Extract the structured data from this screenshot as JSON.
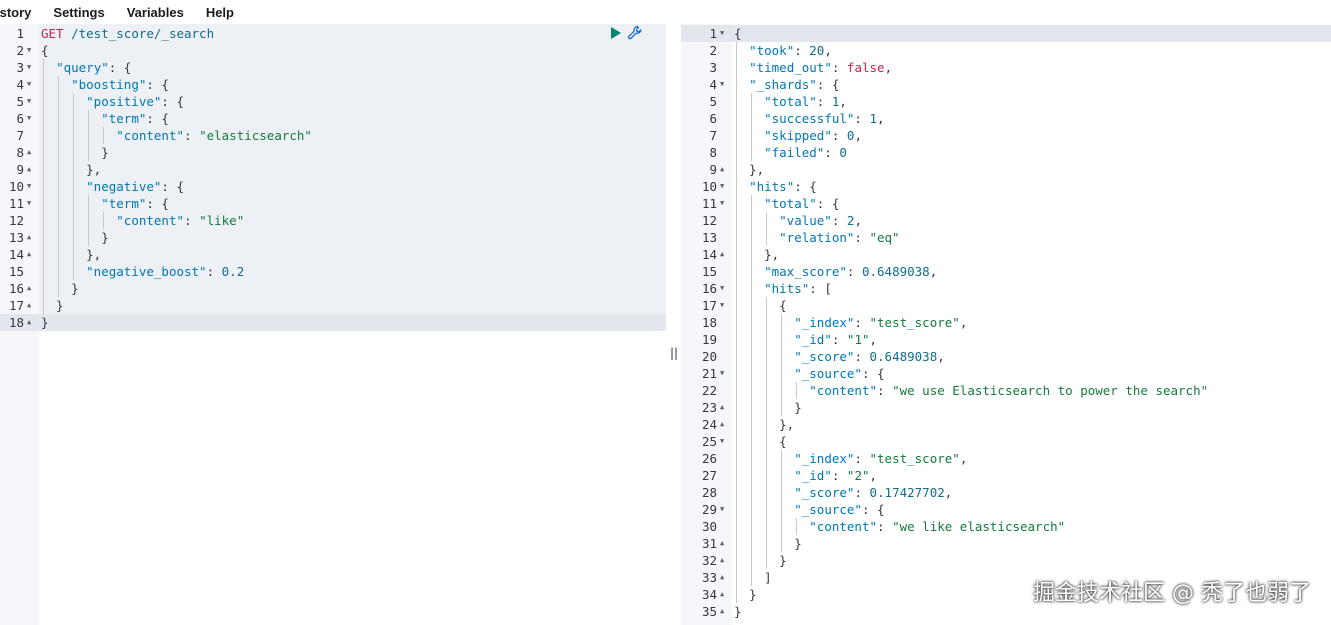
{
  "menu": {
    "items": [
      "istory",
      "Settings",
      "Variables",
      "Help"
    ]
  },
  "request": {
    "lines": [
      {
        "n": "1",
        "fold": "",
        "tokens": [
          [
            "m",
            "GET"
          ],
          [
            "p",
            " "
          ],
          [
            "u",
            "/test_score/_search"
          ]
        ]
      },
      {
        "n": "2",
        "fold": "▼",
        "tokens": [
          [
            "p",
            "{"
          ]
        ]
      },
      {
        "n": "3",
        "fold": "▼",
        "tokens": [
          [
            "p",
            "  "
          ],
          [
            "k",
            "\"query\""
          ],
          [
            "p",
            ": {"
          ]
        ]
      },
      {
        "n": "4",
        "fold": "▼",
        "tokens": [
          [
            "p",
            "    "
          ],
          [
            "k",
            "\"boosting\""
          ],
          [
            "p",
            ": {"
          ]
        ]
      },
      {
        "n": "5",
        "fold": "▼",
        "tokens": [
          [
            "p",
            "      "
          ],
          [
            "k",
            "\"positive\""
          ],
          [
            "p",
            ": {"
          ]
        ]
      },
      {
        "n": "6",
        "fold": "▼",
        "tokens": [
          [
            "p",
            "        "
          ],
          [
            "k",
            "\"term\""
          ],
          [
            "p",
            ": {"
          ]
        ]
      },
      {
        "n": "7",
        "fold": "",
        "tokens": [
          [
            "p",
            "          "
          ],
          [
            "k",
            "\"content\""
          ],
          [
            "p",
            ": "
          ],
          [
            "s",
            "\"elasticsearch\""
          ]
        ]
      },
      {
        "n": "8",
        "fold": "▲",
        "tokens": [
          [
            "p",
            "        }"
          ]
        ]
      },
      {
        "n": "9",
        "fold": "▲",
        "tokens": [
          [
            "p",
            "      },"
          ]
        ]
      },
      {
        "n": "10",
        "fold": "▼",
        "tokens": [
          [
            "p",
            "      "
          ],
          [
            "k",
            "\"negative\""
          ],
          [
            "p",
            ": {"
          ]
        ]
      },
      {
        "n": "11",
        "fold": "▼",
        "tokens": [
          [
            "p",
            "        "
          ],
          [
            "k",
            "\"term\""
          ],
          [
            "p",
            ": {"
          ]
        ]
      },
      {
        "n": "12",
        "fold": "",
        "tokens": [
          [
            "p",
            "          "
          ],
          [
            "k",
            "\"content\""
          ],
          [
            "p",
            ": "
          ],
          [
            "s",
            "\"like\""
          ]
        ]
      },
      {
        "n": "13",
        "fold": "▲",
        "tokens": [
          [
            "p",
            "        }"
          ]
        ]
      },
      {
        "n": "14",
        "fold": "▲",
        "tokens": [
          [
            "p",
            "      },"
          ]
        ]
      },
      {
        "n": "15",
        "fold": "",
        "tokens": [
          [
            "p",
            "      "
          ],
          [
            "k",
            "\"negative_boost\""
          ],
          [
            "p",
            ": "
          ],
          [
            "n",
            "0.2"
          ]
        ]
      },
      {
        "n": "16",
        "fold": "▲",
        "tokens": [
          [
            "p",
            "    }"
          ]
        ]
      },
      {
        "n": "17",
        "fold": "▲",
        "tokens": [
          [
            "p",
            "  }"
          ]
        ]
      },
      {
        "n": "18",
        "fold": "▲",
        "tokens": [
          [
            "p",
            "}"
          ]
        ]
      }
    ]
  },
  "response": {
    "lines": [
      {
        "n": "1",
        "fold": "▼",
        "tokens": [
          [
            "p",
            "{"
          ]
        ]
      },
      {
        "n": "2",
        "fold": "",
        "tokens": [
          [
            "p",
            "  "
          ],
          [
            "k",
            "\"took\""
          ],
          [
            "p",
            ": "
          ],
          [
            "n",
            "20"
          ],
          [
            "p",
            ","
          ]
        ]
      },
      {
        "n": "3",
        "fold": "",
        "tokens": [
          [
            "p",
            "  "
          ],
          [
            "k",
            "\"timed_out\""
          ],
          [
            "p",
            ": "
          ],
          [
            "b",
            "false"
          ],
          [
            "p",
            ","
          ]
        ]
      },
      {
        "n": "4",
        "fold": "▼",
        "tokens": [
          [
            "p",
            "  "
          ],
          [
            "k",
            "\"_shards\""
          ],
          [
            "p",
            ": {"
          ]
        ]
      },
      {
        "n": "5",
        "fold": "",
        "tokens": [
          [
            "p",
            "    "
          ],
          [
            "k",
            "\"total\""
          ],
          [
            "p",
            ": "
          ],
          [
            "n",
            "1"
          ],
          [
            "p",
            ","
          ]
        ]
      },
      {
        "n": "6",
        "fold": "",
        "tokens": [
          [
            "p",
            "    "
          ],
          [
            "k",
            "\"successful\""
          ],
          [
            "p",
            ": "
          ],
          [
            "n",
            "1"
          ],
          [
            "p",
            ","
          ]
        ]
      },
      {
        "n": "7",
        "fold": "",
        "tokens": [
          [
            "p",
            "    "
          ],
          [
            "k",
            "\"skipped\""
          ],
          [
            "p",
            ": "
          ],
          [
            "n",
            "0"
          ],
          [
            "p",
            ","
          ]
        ]
      },
      {
        "n": "8",
        "fold": "",
        "tokens": [
          [
            "p",
            "    "
          ],
          [
            "k",
            "\"failed\""
          ],
          [
            "p",
            ": "
          ],
          [
            "n",
            "0"
          ]
        ]
      },
      {
        "n": "9",
        "fold": "▲",
        "tokens": [
          [
            "p",
            "  },"
          ]
        ]
      },
      {
        "n": "10",
        "fold": "▼",
        "tokens": [
          [
            "p",
            "  "
          ],
          [
            "k",
            "\"hits\""
          ],
          [
            "p",
            ": {"
          ]
        ]
      },
      {
        "n": "11",
        "fold": "▼",
        "tokens": [
          [
            "p",
            "    "
          ],
          [
            "k",
            "\"total\""
          ],
          [
            "p",
            ": {"
          ]
        ]
      },
      {
        "n": "12",
        "fold": "",
        "tokens": [
          [
            "p",
            "      "
          ],
          [
            "k",
            "\"value\""
          ],
          [
            "p",
            ": "
          ],
          [
            "n",
            "2"
          ],
          [
            "p",
            ","
          ]
        ]
      },
      {
        "n": "13",
        "fold": "",
        "tokens": [
          [
            "p",
            "      "
          ],
          [
            "k",
            "\"relation\""
          ],
          [
            "p",
            ": "
          ],
          [
            "s",
            "\"eq\""
          ]
        ]
      },
      {
        "n": "14",
        "fold": "▲",
        "tokens": [
          [
            "p",
            "    },"
          ]
        ]
      },
      {
        "n": "15",
        "fold": "",
        "tokens": [
          [
            "p",
            "    "
          ],
          [
            "k",
            "\"max_score\""
          ],
          [
            "p",
            ": "
          ],
          [
            "n",
            "0.6489038"
          ],
          [
            "p",
            ","
          ]
        ]
      },
      {
        "n": "16",
        "fold": "▼",
        "tokens": [
          [
            "p",
            "    "
          ],
          [
            "k",
            "\"hits\""
          ],
          [
            "p",
            ": ["
          ]
        ]
      },
      {
        "n": "17",
        "fold": "▼",
        "tokens": [
          [
            "p",
            "      {"
          ]
        ]
      },
      {
        "n": "18",
        "fold": "",
        "tokens": [
          [
            "p",
            "        "
          ],
          [
            "k",
            "\"_index\""
          ],
          [
            "p",
            ": "
          ],
          [
            "s",
            "\"test_score\""
          ],
          [
            "p",
            ","
          ]
        ]
      },
      {
        "n": "19",
        "fold": "",
        "tokens": [
          [
            "p",
            "        "
          ],
          [
            "k",
            "\"_id\""
          ],
          [
            "p",
            ": "
          ],
          [
            "s",
            "\"1\""
          ],
          [
            "p",
            ","
          ]
        ]
      },
      {
        "n": "20",
        "fold": "",
        "tokens": [
          [
            "p",
            "        "
          ],
          [
            "k",
            "\"_score\""
          ],
          [
            "p",
            ": "
          ],
          [
            "n",
            "0.6489038"
          ],
          [
            "p",
            ","
          ]
        ]
      },
      {
        "n": "21",
        "fold": "▼",
        "tokens": [
          [
            "p",
            "        "
          ],
          [
            "k",
            "\"_source\""
          ],
          [
            "p",
            ": {"
          ]
        ]
      },
      {
        "n": "22",
        "fold": "",
        "tokens": [
          [
            "p",
            "          "
          ],
          [
            "k",
            "\"content\""
          ],
          [
            "p",
            ": "
          ],
          [
            "s",
            "\"we use Elasticsearch to power the search\""
          ]
        ]
      },
      {
        "n": "23",
        "fold": "▲",
        "tokens": [
          [
            "p",
            "        }"
          ]
        ]
      },
      {
        "n": "24",
        "fold": "▲",
        "tokens": [
          [
            "p",
            "      },"
          ]
        ]
      },
      {
        "n": "25",
        "fold": "▼",
        "tokens": [
          [
            "p",
            "      {"
          ]
        ]
      },
      {
        "n": "26",
        "fold": "",
        "tokens": [
          [
            "p",
            "        "
          ],
          [
            "k",
            "\"_index\""
          ],
          [
            "p",
            ": "
          ],
          [
            "s",
            "\"test_score\""
          ],
          [
            "p",
            ","
          ]
        ]
      },
      {
        "n": "27",
        "fold": "",
        "tokens": [
          [
            "p",
            "        "
          ],
          [
            "k",
            "\"_id\""
          ],
          [
            "p",
            ": "
          ],
          [
            "s",
            "\"2\""
          ],
          [
            "p",
            ","
          ]
        ]
      },
      {
        "n": "28",
        "fold": "",
        "tokens": [
          [
            "p",
            "        "
          ],
          [
            "k",
            "\"_score\""
          ],
          [
            "p",
            ": "
          ],
          [
            "n",
            "0.17427702"
          ],
          [
            "p",
            ","
          ]
        ]
      },
      {
        "n": "29",
        "fold": "▼",
        "tokens": [
          [
            "p",
            "        "
          ],
          [
            "k",
            "\"_source\""
          ],
          [
            "p",
            ": {"
          ]
        ]
      },
      {
        "n": "30",
        "fold": "",
        "tokens": [
          [
            "p",
            "          "
          ],
          [
            "k",
            "\"content\""
          ],
          [
            "p",
            ": "
          ],
          [
            "s",
            "\"we like elasticsearch\""
          ]
        ]
      },
      {
        "n": "31",
        "fold": "▲",
        "tokens": [
          [
            "p",
            "        }"
          ]
        ]
      },
      {
        "n": "32",
        "fold": "▲",
        "tokens": [
          [
            "p",
            "      }"
          ]
        ]
      },
      {
        "n": "33",
        "fold": "▲",
        "tokens": [
          [
            "p",
            "    ]"
          ]
        ]
      },
      {
        "n": "34",
        "fold": "▲",
        "tokens": [
          [
            "p",
            "  }"
          ]
        ]
      },
      {
        "n": "35",
        "fold": "▲",
        "tokens": [
          [
            "p",
            "}"
          ]
        ]
      }
    ]
  },
  "icons": {
    "run": "play-icon",
    "settings": "wrench-icon"
  },
  "splitter_glyph": "||",
  "watermark": "掘金技术社区 @ 秃了也弱了",
  "colors": {
    "key": "#0077b6",
    "string": "#157a3c",
    "number": "#0f6d8f",
    "method": "#c4264d",
    "run": "#00876c"
  }
}
